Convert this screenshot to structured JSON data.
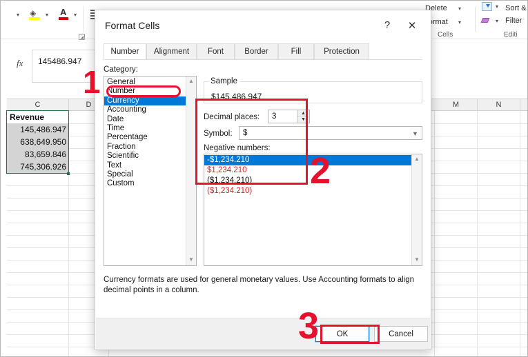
{
  "app": {
    "ribbon": {
      "fill_color_icon": "fill-color-icon",
      "font_color_icon": "font-color-icon",
      "align_icon": "alignment-icon",
      "groups": [
        {
          "label": "Cells"
        },
        {
          "label": "Editi"
        }
      ],
      "buttons": [
        {
          "label": "Delete"
        },
        {
          "label": "Format"
        },
        {
          "label": "Sort &"
        },
        {
          "label": "Filter"
        }
      ]
    },
    "formula_bar": {
      "fx_icon": "function-icon",
      "value": "145486.947"
    },
    "sheet": {
      "columns": [
        "C",
        "D",
        "M",
        "N"
      ],
      "header_cell": "Revenue",
      "cells": [
        "145,486.947",
        "638,649.950",
        "83,659.846",
        "745,306.926"
      ]
    }
  },
  "dialog": {
    "title": "Format Cells",
    "help_icon": "help-icon",
    "close_icon": "close-icon",
    "tabs": [
      {
        "label": "Number",
        "active": true
      },
      {
        "label": "Alignment",
        "active": false
      },
      {
        "label": "Font",
        "active": false
      },
      {
        "label": "Border",
        "active": false
      },
      {
        "label": "Fill",
        "active": false
      },
      {
        "label": "Protection",
        "active": false
      }
    ],
    "category": {
      "label": "Category:",
      "items": [
        "General",
        "Number",
        "Currency",
        "Accounting",
        "Date",
        "Time",
        "Percentage",
        "Fraction",
        "Scientific",
        "Text",
        "Special",
        "Custom"
      ],
      "selected": "Currency",
      "scroll_up_icon": "chevron-up-icon",
      "scroll_down_icon": "chevron-down-icon"
    },
    "sample": {
      "title": "Sample",
      "value": "$145,486.947"
    },
    "decimal_places": {
      "label": "Decimal places:",
      "value": "3",
      "spin_up_icon": "spinner-up-icon",
      "spin_down_icon": "spinner-down-icon"
    },
    "symbol": {
      "label": "Symbol:",
      "value": "$",
      "arrow_icon": "chevron-down-icon"
    },
    "negative_numbers": {
      "label": "Negative numbers:",
      "items": [
        {
          "text": "-$1,234.210",
          "color": "black",
          "selected": true
        },
        {
          "text": "$1,234.210",
          "color": "red",
          "selected": false
        },
        {
          "text": "($1,234.210)",
          "color": "black",
          "selected": false
        },
        {
          "text": "($1,234.210)",
          "color": "red",
          "selected": false
        }
      ],
      "scroll_up_icon": "chevron-up-icon",
      "scroll_down_icon": "chevron-down-icon"
    },
    "description": "Currency formats are used for general monetary values.  Use Accounting formats to align decimal points in a column.",
    "ok_label": "OK",
    "cancel_label": "Cancel"
  },
  "annotations": {
    "step1": "1",
    "step2": "2",
    "step3": "3",
    "color": "#e8112d"
  }
}
